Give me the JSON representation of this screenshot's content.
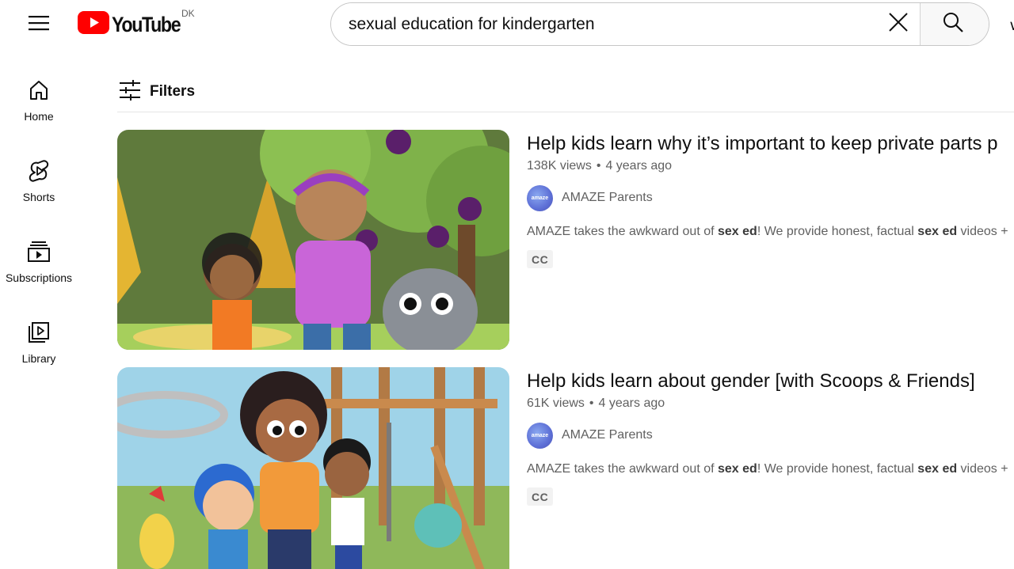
{
  "header": {
    "logo_text": "YouTube",
    "country_code": "DK",
    "search_value": "sexual education for kindergarten",
    "edge_glyph": "∨"
  },
  "sidebar": {
    "items": [
      {
        "label": "Home",
        "icon": "home-icon"
      },
      {
        "label": "Shorts",
        "icon": "shorts-icon"
      },
      {
        "label": "Subscriptions",
        "icon": "subscriptions-icon"
      },
      {
        "label": "Library",
        "icon": "library-icon"
      }
    ]
  },
  "filters": {
    "label": "Filters"
  },
  "results": [
    {
      "title": "Help kids learn why it’s important to keep private parts p",
      "views": "138K views",
      "age": "4 years ago",
      "channel": "AMAZE Parents",
      "avatar_text": "amaze",
      "desc_parts": [
        "AMAZE takes the awkward out of ",
        "sex ed",
        "! We provide honest, factual ",
        "sex ed",
        " videos +"
      ],
      "badge": "CC"
    },
    {
      "title": "Help kids learn about gender [with Scoops & Friends]",
      "views": "61K views",
      "age": "4 years ago",
      "channel": "AMAZE Parents",
      "avatar_text": "amaze",
      "desc_parts": [
        "AMAZE takes the awkward out of ",
        "sex ed",
        "! We provide honest, factual ",
        "sex ed",
        " videos +"
      ],
      "badge": "CC"
    }
  ],
  "colors": {
    "brand_red": "#ff0000",
    "text_primary": "#0f0f0f",
    "text_secondary": "#606060"
  }
}
